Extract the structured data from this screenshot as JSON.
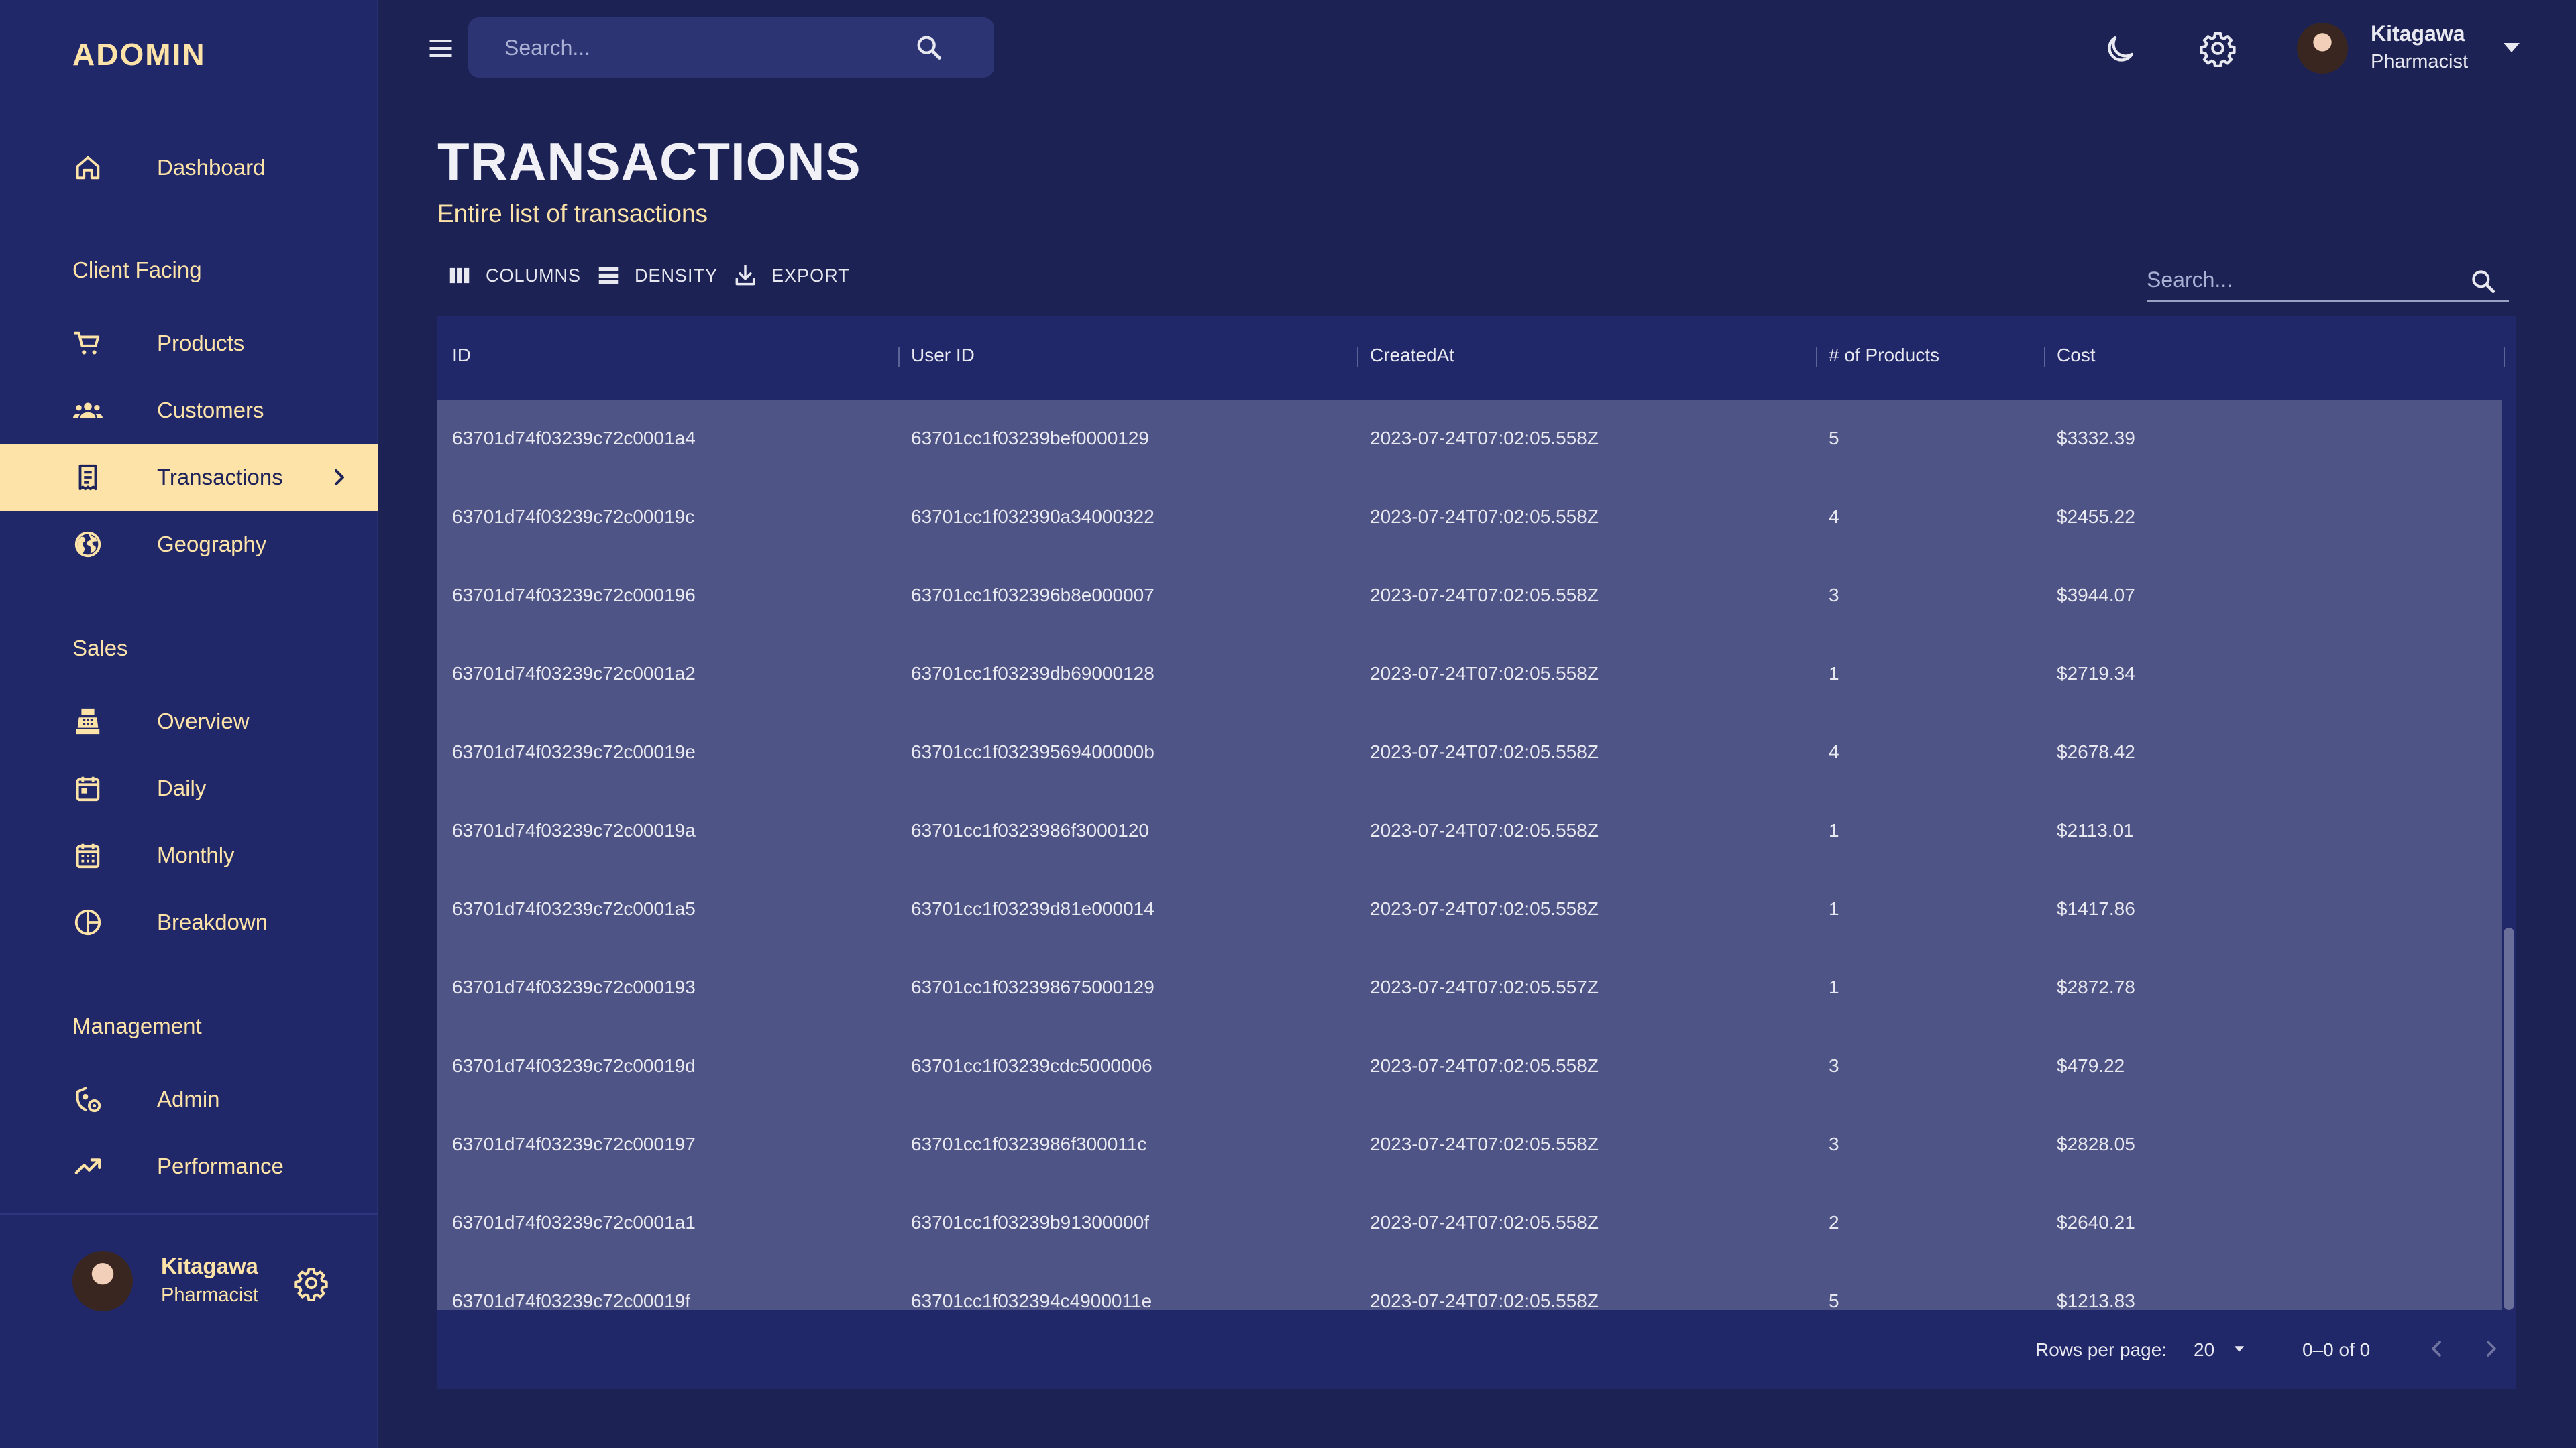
{
  "app": {
    "brand": "ADOMIN"
  },
  "sidebar": {
    "items": [
      {
        "label": "Dashboard",
        "icon": "home-icon"
      },
      {
        "label": "Products",
        "icon": "cart-icon"
      },
      {
        "label": "Customers",
        "icon": "groups-icon"
      },
      {
        "label": "Transactions",
        "icon": "receipt-icon",
        "active": true
      },
      {
        "label": "Geography",
        "icon": "globe-icon"
      },
      {
        "label": "Overview",
        "icon": "point-of-sale-icon"
      },
      {
        "label": "Daily",
        "icon": "calendar-today-icon"
      },
      {
        "label": "Monthly",
        "icon": "calendar-month-icon"
      },
      {
        "label": "Breakdown",
        "icon": "pie-chart-icon"
      },
      {
        "label": "Admin",
        "icon": "admin-settings-icon"
      },
      {
        "label": "Performance",
        "icon": "trending-up-icon"
      }
    ],
    "sections": [
      "Client Facing",
      "Sales",
      "Management"
    ],
    "user": {
      "name": "Kitagawa",
      "role": "Pharmacist"
    }
  },
  "topbar": {
    "search_placeholder": "Search...",
    "user": {
      "name": "Kitagawa",
      "role": "Pharmacist"
    }
  },
  "page": {
    "title": "TRANSACTIONS",
    "subtitle": "Entire list of transactions"
  },
  "toolbar": {
    "columns_label": "COLUMNS",
    "density_label": "DENSITY",
    "export_label": "EXPORT",
    "search_placeholder": "Search..."
  },
  "table": {
    "columns": [
      "ID",
      "User ID",
      "CreatedAt",
      "# of Products",
      "Cost"
    ],
    "rows": [
      [
        "63701d74f03239c72c0001a4",
        "63701cc1f03239bef0000129",
        "2023-07-24T07:02:05.558Z",
        "5",
        "$3332.39"
      ],
      [
        "63701d74f03239c72c00019c",
        "63701cc1f032390a34000322",
        "2023-07-24T07:02:05.558Z",
        "4",
        "$2455.22"
      ],
      [
        "63701d74f03239c72c000196",
        "63701cc1f032396b8e000007",
        "2023-07-24T07:02:05.558Z",
        "3",
        "$3944.07"
      ],
      [
        "63701d74f03239c72c0001a2",
        "63701cc1f03239db69000128",
        "2023-07-24T07:02:05.558Z",
        "1",
        "$2719.34"
      ],
      [
        "63701d74f03239c72c00019e",
        "63701cc1f03239569400000b",
        "2023-07-24T07:02:05.558Z",
        "4",
        "$2678.42"
      ],
      [
        "63701d74f03239c72c00019a",
        "63701cc1f0323986f3000120",
        "2023-07-24T07:02:05.558Z",
        "1",
        "$2113.01"
      ],
      [
        "63701d74f03239c72c0001a5",
        "63701cc1f03239d81e000014",
        "2023-07-24T07:02:05.558Z",
        "1",
        "$1417.86"
      ],
      [
        "63701d74f03239c72c000193",
        "63701cc1f032398675000129",
        "2023-07-24T07:02:05.557Z",
        "1",
        "$2872.78"
      ],
      [
        "63701d74f03239c72c00019d",
        "63701cc1f03239cdc5000006",
        "2023-07-24T07:02:05.558Z",
        "3",
        "$479.22"
      ],
      [
        "63701d74f03239c72c000197",
        "63701cc1f0323986f300011c",
        "2023-07-24T07:02:05.558Z",
        "3",
        "$2828.05"
      ],
      [
        "63701d74f03239c72c0001a1",
        "63701cc1f03239b91300000f",
        "2023-07-24T07:02:05.558Z",
        "2",
        "$2640.21"
      ],
      [
        "63701d74f03239c72c00019f",
        "63701cc1f032394c4900011e",
        "2023-07-24T07:02:05.558Z",
        "5",
        "$1213.83"
      ]
    ]
  },
  "pagination": {
    "rows_per_page_label": "Rows per page:",
    "rows_per_page": "20",
    "range_text": "0–0 of 0"
  },
  "colors": {
    "background": "#1c2254",
    "sidebar": "#202869",
    "accent": "#fde3a7",
    "row_background": "#4f5486"
  }
}
